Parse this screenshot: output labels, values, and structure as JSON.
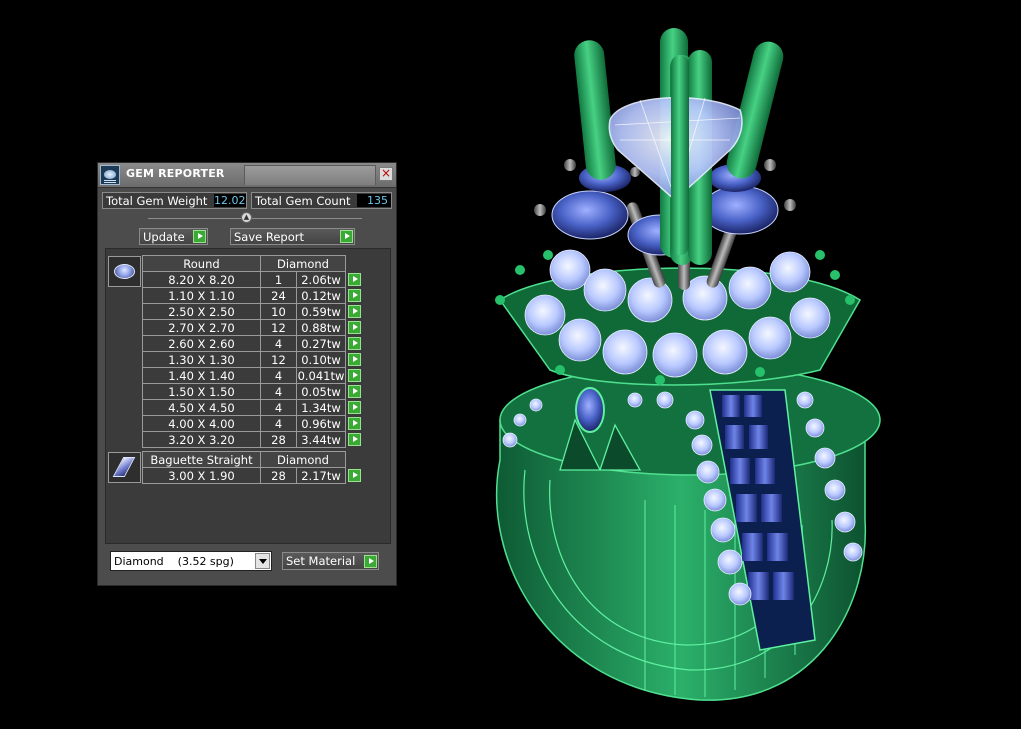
{
  "panel": {
    "title": "GEM REPORTER",
    "close_symbol": "×",
    "total_weight_label": "Total Gem Weight",
    "total_weight_value": "12.02",
    "total_count_label": "Total Gem Count",
    "total_count_value": "135",
    "update_label": "Update",
    "save_report_label": "Save Report",
    "splitter_symbol": "▲"
  },
  "round_group": {
    "shape": "Round",
    "material": "Diamond",
    "rows": [
      {
        "size": "8.20 X 8.20",
        "count": "1",
        "weight": "2.06tw"
      },
      {
        "size": "1.10 X 1.10",
        "count": "24",
        "weight": "0.12tw"
      },
      {
        "size": "2.50 X 2.50",
        "count": "10",
        "weight": "0.59tw"
      },
      {
        "size": "2.70 X 2.70",
        "count": "12",
        "weight": "0.88tw"
      },
      {
        "size": "2.60 X 2.60",
        "count": "4",
        "weight": "0.27tw"
      },
      {
        "size": "1.30 X 1.30",
        "count": "12",
        "weight": "0.10tw"
      },
      {
        "size": "1.40 X 1.40",
        "count": "4",
        "weight": "0.041tw"
      },
      {
        "size": "1.50 X 1.50",
        "count": "4",
        "weight": "0.05tw"
      },
      {
        "size": "4.50 X 4.50",
        "count": "4",
        "weight": "1.34tw"
      },
      {
        "size": "4.00 X 4.00",
        "count": "4",
        "weight": "0.96tw"
      },
      {
        "size": "3.20 X 3.20",
        "count": "28",
        "weight": "3.44tw"
      }
    ]
  },
  "baguette_group": {
    "shape": "Baguette Straight",
    "material": "Diamond",
    "rows": [
      {
        "size": "3.00 X 1.90",
        "count": "28",
        "weight": "2.17tw"
      }
    ]
  },
  "material_select": {
    "value": "Diamond    (3.52 spg)"
  },
  "set_material_label": "Set Material",
  "colors": {
    "panel_bg": "#4c4c4c",
    "value_text": "#6fc4e8",
    "go_green": "#3aa935",
    "metal_green": "#1f8f55",
    "stone_blue": "#4a63c8",
    "stone_pale": "#b9c9ff"
  }
}
